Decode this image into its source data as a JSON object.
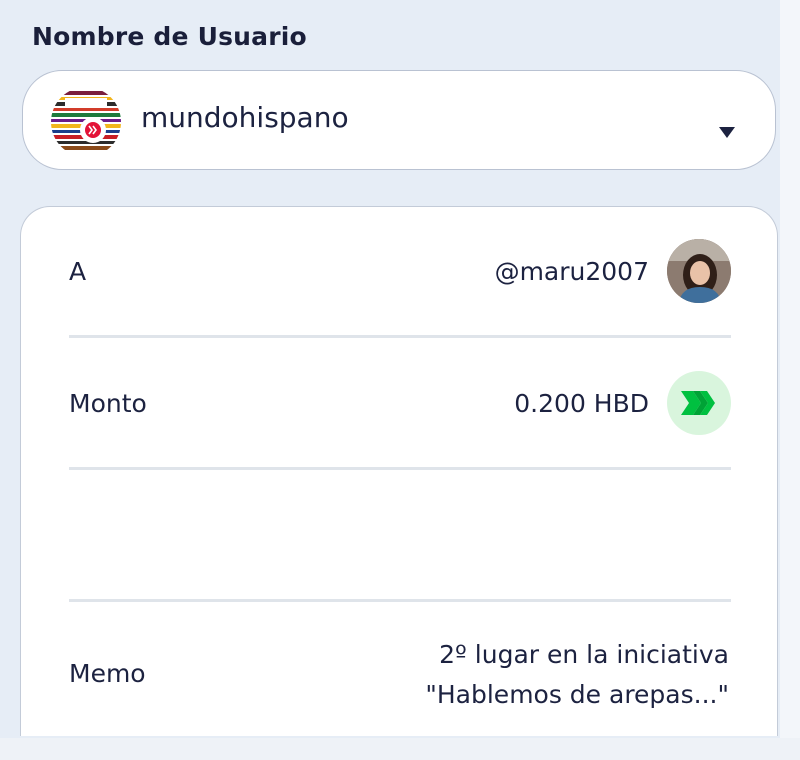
{
  "header": {
    "username_label": "Nombre de Usuario"
  },
  "account_select": {
    "username": "mundohispano",
    "avatar_icon": "mundohispano-logo-icon",
    "caret_icon": "caret-down-icon"
  },
  "transfer": {
    "to": {
      "label": "A",
      "value": "@maru2007",
      "avatar_icon": "user-avatar-icon"
    },
    "amount": {
      "label": "Monto",
      "value": "0.200 HBD",
      "currency_icon": "hbd-icon",
      "currency_color": "#00c040"
    },
    "memo": {
      "label": "Memo",
      "line1": "2º lugar en la iniciativa",
      "line2": "\"Hablemos de arepas...\""
    }
  },
  "colors": {
    "background": "#e6edf6",
    "card": "#ffffff",
    "text": "#1c2240",
    "hive_red": "#e31337"
  }
}
